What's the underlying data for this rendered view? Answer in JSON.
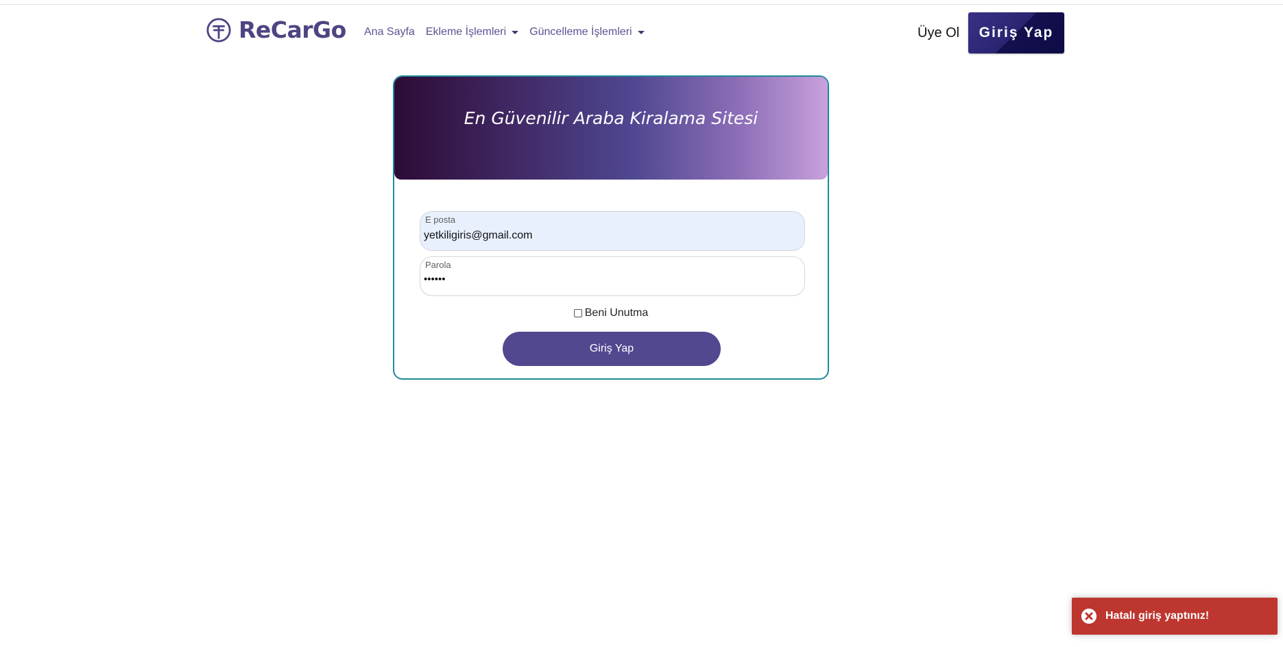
{
  "navbar": {
    "brand": "ReCarGo",
    "links": [
      {
        "label": "Ana Sayfa",
        "dropdown": false
      },
      {
        "label": "Ekleme İşlemleri",
        "dropdown": true
      },
      {
        "label": "Güncelleme İşlemleri",
        "dropdown": true
      }
    ],
    "signup_label": "Üye Ol",
    "login_label": "Giriş Yap"
  },
  "login_card": {
    "title": "En Güvenilir Araba Kiralama Sitesi",
    "email_label": "E posta",
    "email_value": "yetkiligiris@gmail.com",
    "password_label": "Parola",
    "password_mask": "••••••",
    "remember_label": "Beni Unutma",
    "remember_checked": false,
    "submit_label": "Giriş Yap"
  },
  "toast": {
    "type": "error",
    "message": "Hatalı giriş yaptınız!",
    "icon": "close-circle-icon"
  },
  "colors": {
    "brand": "#4f4482",
    "accent_button": "#524890",
    "card_border": "#1e8a98",
    "toast_error": "#bd362f"
  }
}
